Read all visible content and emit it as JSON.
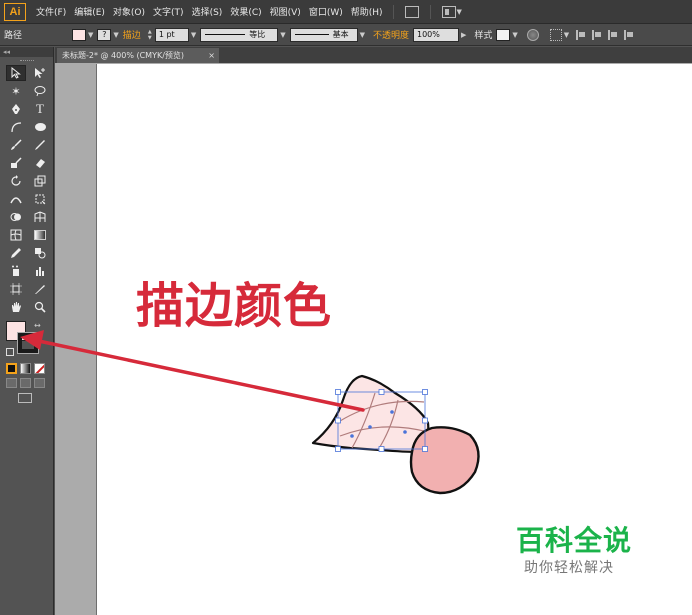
{
  "app": {
    "logo": "Ai"
  },
  "menu": {
    "items": [
      "文件(F)",
      "编辑(E)",
      "对象(O)",
      "文字(T)",
      "选择(S)",
      "效果(C)",
      "视图(V)",
      "窗口(W)",
      "帮助(H)"
    ]
  },
  "control_bar": {
    "path_label": "路径",
    "fill_swatch_color": "#fde3e3",
    "stroke_label": "描边",
    "stroke_weight": "1 pt",
    "profile_label": "等比",
    "brush_label": "基本",
    "opacity_label": "不透明度",
    "opacity_value": "100%",
    "style_label": "样式"
  },
  "document": {
    "tab_title": "未标题-2* @ 400% (CMYK/预览)",
    "tab_close": "×"
  },
  "tools": {
    "panel_collapse": "◂◂",
    "fill_color": "#fde3e3",
    "stroke_color": "#1a1a1a"
  },
  "annotation": {
    "text": "描边颜色",
    "color": "#d62a3a"
  },
  "artwork": {
    "shuttle_fill": "#fce5e5",
    "cork_fill": "#f2b0b0",
    "outline_color": "#111111",
    "selection_color": "#4a73d9"
  },
  "watermark": {
    "title": "百科全说",
    "subtitle": "助你轻松解决",
    "title_color": "#1bb34a"
  }
}
